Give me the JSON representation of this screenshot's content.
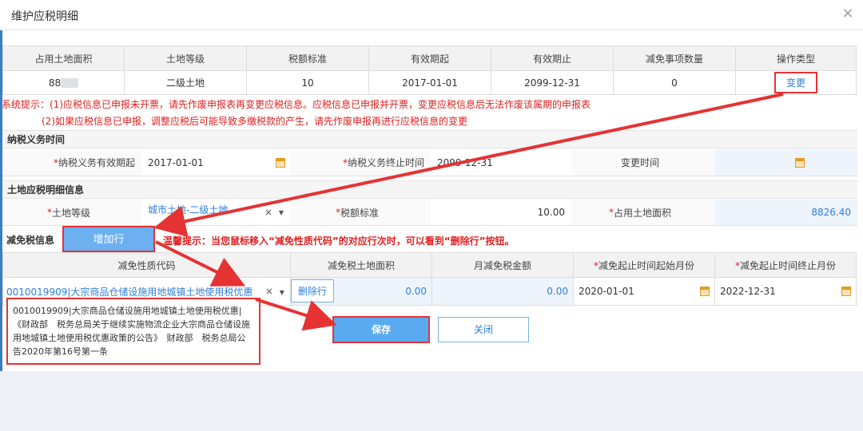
{
  "dialog": {
    "title": "维护应税明细"
  },
  "summary": {
    "headers": [
      "占用土地面积",
      "土地等级",
      "税额标准",
      "有效期起",
      "有效期止",
      "减免事项数量",
      "操作类型"
    ],
    "row": {
      "area_visible": "88",
      "grade": "二级土地",
      "tax_standard": "10",
      "valid_from": "2017-01-01",
      "valid_to": "2099-12-31",
      "relief_count": "0",
      "action": "变更"
    }
  },
  "system_tips": {
    "line1": "系统提示：(1)应税信息已申报未开票，请先作废申报表再变更应税信息。应税信息已申报并开票，变更应税信息后无法作废该属期的申报表",
    "line2": "(2)如果应税信息已申报，调整应税后可能导致多缴税款的产生，请先作废申报再进行应税信息的变更"
  },
  "obligation": {
    "section_title": "纳税义务时间",
    "start_label": "纳税义务有效期起",
    "start_value": "2017-01-01",
    "end_label": "纳税义务终止时间",
    "end_value": "2099-12-31",
    "change_label": "变更时间",
    "change_value": ""
  },
  "detail": {
    "section_title": "土地应税明细信息",
    "grade_label": "土地等级",
    "grade_value": "城市土地-二级土地",
    "tax_label": "税额标准",
    "tax_value": "10.00",
    "area_label": "占用土地面积",
    "area_value": "8826.40"
  },
  "relief": {
    "section_title": "减免税信息",
    "add_button": "增加行",
    "tip": "温馨提示：当您鼠标移入“减免性质代码”的对应行次时，可以看到“删除行”按钮。",
    "headers": [
      "减免性质代码",
      "减免税土地面积",
      "月减免税金额",
      "减免起止时间起始月份",
      "减免起止时间终止月份"
    ],
    "row": {
      "code": "0010019909|大宗商品仓储设施用地城镇土地使用税优惠",
      "delete_button": "删除行",
      "area": "0.00",
      "monthly_amount": "0.00",
      "start_month": "2020-01-01",
      "end_month": "2022-12-31"
    },
    "tooltip": "0010019909|大宗商品仓储设施用地城镇土地使用税优惠|《财政部　税务总局关于继续实施物流企业大宗商品仓储设施用地城镇土地使用税优惠政策的公告》　财政部　税务总局公告2020年第16号第一条"
  },
  "footer": {
    "save": "保存",
    "close": "关闭"
  },
  "icons": {
    "close": "close-icon",
    "calendar": "calendar-icon",
    "clear": "clear-icon",
    "dropdown": "chevron-down-icon"
  },
  "colors": {
    "accent": "#2f7ed8",
    "warning": "#e02020",
    "highlight": "#e53333",
    "button": "#5aaaf0"
  }
}
